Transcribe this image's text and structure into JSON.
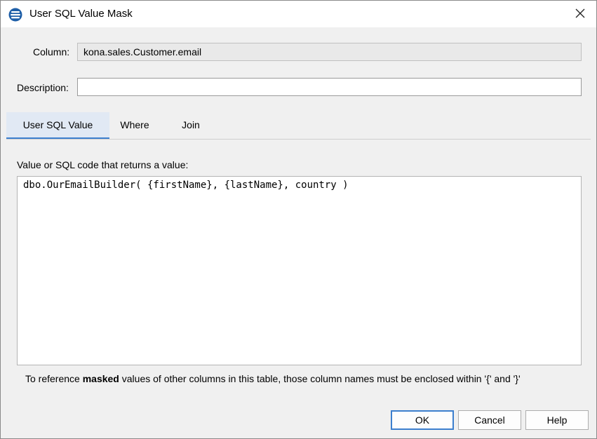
{
  "window": {
    "title": "User SQL Value Mask",
    "icon": "database-stack-icon"
  },
  "form": {
    "column_label": "Column:",
    "column_value": "kona.sales.Customer.email",
    "description_label": "Description:",
    "description_value": ""
  },
  "tabs": [
    {
      "label": "User SQL Value",
      "active": true
    },
    {
      "label": "Where",
      "active": false
    },
    {
      "label": "Join",
      "active": false
    }
  ],
  "sql": {
    "label": "Value or SQL code that returns a value:",
    "code": "dbo.OurEmailBuilder( {firstName}, {lastName}, country )"
  },
  "hint": {
    "prefix": "To reference ",
    "bold": "masked",
    "suffix": " values of other columns in this table, those column names must be enclosed within '{' and '}'"
  },
  "buttons": {
    "ok": "OK",
    "cancel": "Cancel",
    "help": "Help"
  },
  "colors": {
    "accent": "#3c7fce",
    "active_tab_bg": "#e1e9f4"
  }
}
